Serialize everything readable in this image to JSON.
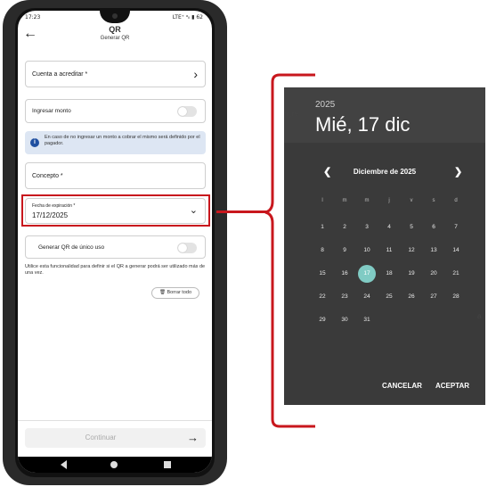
{
  "status_bar": {
    "time": "17:23",
    "right": "LTE⁺ ᵃᵢₗ ▮ 62"
  },
  "header": {
    "title": "QR",
    "subtitle": "Generar QR"
  },
  "form": {
    "cuenta_label": "Cuenta a acreditar *",
    "ingresar_monto_label": "Ingresar monto",
    "info_text": "En caso de no ingresar un monto a cobrar el mismo será definido por el pagador.",
    "concepto_label": "Concepto *",
    "fecha_label": "Fecha de expiración *",
    "fecha_value": "17/12/2025",
    "unico_uso_label": "Generar QR de único uso",
    "help_text": "Utilice esta funcionalidad para definir si el QR a generar podrá ser utilizado más de una vez.",
    "borrar_label": "🗑 Borrar todo",
    "continuar_label": "Continuar"
  },
  "datepicker": {
    "year": "2025",
    "selected_date": "Mié, 17 dic",
    "month_label": "Diciembre de 2025",
    "weekdays": [
      "l",
      "m",
      "m",
      "j",
      "v",
      "s",
      "d"
    ],
    "days": [
      "1",
      "2",
      "3",
      "4",
      "5",
      "6",
      "7",
      "8",
      "9",
      "10",
      "11",
      "12",
      "13",
      "14",
      "15",
      "16",
      "17",
      "18",
      "19",
      "20",
      "21",
      "22",
      "23",
      "24",
      "25",
      "26",
      "27",
      "28",
      "29",
      "30",
      "31"
    ],
    "selected_day": "17",
    "cancel_label": "CANCELAR",
    "accept_label": "ACEPTAR"
  },
  "colors": {
    "highlight": "#c8171d",
    "picker_bg": "#3a3a3a",
    "selected_day": "#80cbc4",
    "info_bg": "#dde6f3"
  },
  "icons": [
    "back-arrow-icon",
    "chevron-right-icon",
    "info-icon",
    "chevron-down-icon",
    "trash-icon",
    "arrow-right-icon",
    "prev-month-icon",
    "next-month-icon"
  ]
}
